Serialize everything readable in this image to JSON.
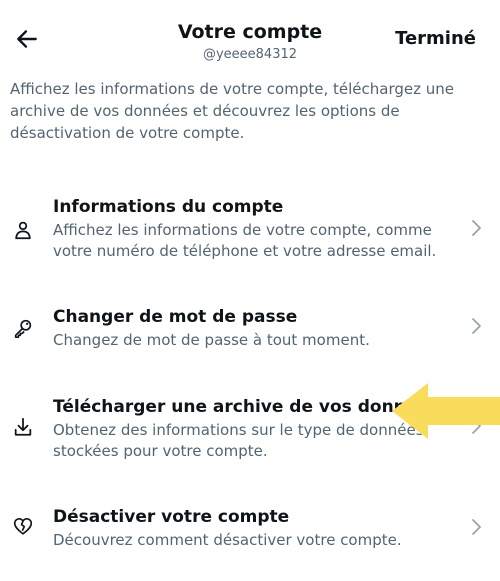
{
  "header": {
    "title": "Votre compte",
    "handle": "@yeeee84312",
    "done_label": "Terminé",
    "back_icon": "back-arrow-icon"
  },
  "intro": "Affichez les informations de votre compte, téléchargez une archive de vos données et découvrez les options de désactivation de votre compte.",
  "items": [
    {
      "label": "Informations du compte",
      "description": "Affichez les informations de votre compte, comme votre numéro de téléphone et votre adresse email.",
      "icon": "person-icon"
    },
    {
      "label": "Changer de mot de passe",
      "description": "Changez de mot de passe à tout moment.",
      "icon": "key-icon"
    },
    {
      "label": "Télécharger une archive de vos données",
      "description": "Obtenez des informations sur le type de données stockées pour votre compte.",
      "icon": "download-icon"
    },
    {
      "label": "Désactiver votre compte",
      "description": "Découvrez comment désactiver votre compte.",
      "icon": "broken-heart-icon"
    }
  ],
  "colors": {
    "text": "#0f1419",
    "secondary": "#536471",
    "chevron": "#9aa3ab",
    "highlight_arrow": "#f9dc5c"
  }
}
